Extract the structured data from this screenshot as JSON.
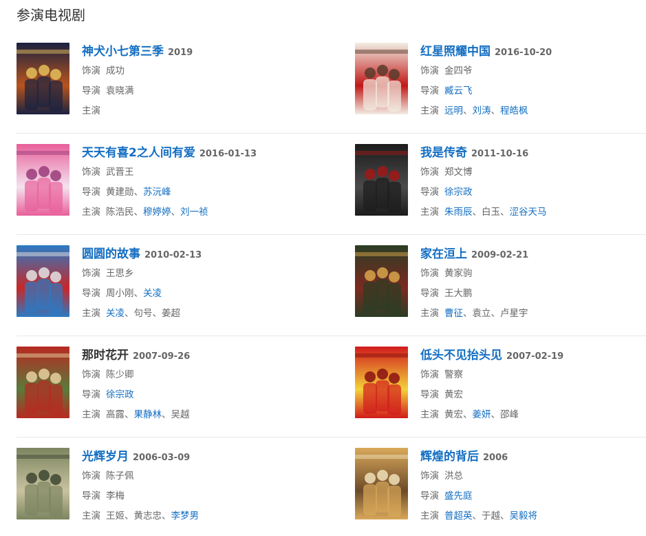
{
  "section_title": "参演电视剧",
  "labels": {
    "role": "饰演",
    "director": "导演",
    "cast": "主演"
  },
  "dramas": [
    {
      "title": "神犬小七第三季",
      "title_link": true,
      "year": "2019",
      "role": "成功",
      "directors": [
        {
          "name": "袁晓满",
          "link": false
        }
      ],
      "cast": [],
      "poster_colors": [
        "#1a2240",
        "#b8541e",
        "#e3c05b"
      ]
    },
    {
      "title": "红星照耀中国",
      "title_link": true,
      "year": "2016-10-20",
      "role": "金四爷",
      "directors": [
        {
          "name": "臧云飞",
          "link": true
        }
      ],
      "cast": [
        {
          "name": "远明",
          "link": true
        },
        {
          "name": "刘涛",
          "link": true
        },
        {
          "name": "程皓枫",
          "link": true
        }
      ],
      "poster_colors": [
        "#f2ede3",
        "#c01818",
        "#5a3b2c"
      ]
    },
    {
      "title": "天天有喜2之人间有爱",
      "title_link": true,
      "year": "2016-01-13",
      "role": "武晋王",
      "directors": [
        {
          "name": "黄建勋",
          "link": false
        },
        {
          "name": "苏沅峰",
          "link": true
        }
      ],
      "cast": [
        {
          "name": "陈浩民",
          "link": false
        },
        {
          "name": "穆婷婷",
          "link": true
        },
        {
          "name": "刘一祯",
          "link": true
        }
      ],
      "poster_colors": [
        "#e85f9a",
        "#f4e3ef",
        "#9a3b7a"
      ]
    },
    {
      "title": "我是传奇",
      "title_link": true,
      "year": "2011-10-16",
      "role": "郑文博",
      "directors": [
        {
          "name": "徐宗政",
          "link": true
        }
      ],
      "cast": [
        {
          "name": "朱雨辰",
          "link": true
        },
        {
          "name": "白玉",
          "link": false
        },
        {
          "name": "涩谷天马",
          "link": true
        }
      ],
      "poster_colors": [
        "#1c1c1c",
        "#4a4a4a",
        "#a01818"
      ]
    },
    {
      "title": "圆圆的故事",
      "title_link": true,
      "year": "2010-02-13",
      "role": "王思乡",
      "directors": [
        {
          "name": "周小刚",
          "link": false
        },
        {
          "name": "关凌",
          "link": true
        }
      ],
      "cast": [
        {
          "name": "关凌",
          "link": true
        },
        {
          "name": "句号",
          "link": false
        },
        {
          "name": "姜超",
          "link": false
        }
      ],
      "poster_colors": [
        "#2a7bc4",
        "#c82828",
        "#e3e3e3"
      ]
    },
    {
      "title": "家在洹上",
      "title_link": true,
      "year": "2009-02-21",
      "role": "黄家驹",
      "directors": [
        {
          "name": "王大鹏",
          "link": false
        }
      ],
      "cast": [
        {
          "name": "曹征",
          "link": true
        },
        {
          "name": "袁立",
          "link": false
        },
        {
          "name": "卢星宇",
          "link": false
        }
      ],
      "poster_colors": [
        "#2b3d24",
        "#7c2a20",
        "#d8a54a"
      ]
    },
    {
      "title": "那时花开",
      "title_link": false,
      "year": "2007-09-26",
      "role": "陈少卿",
      "directors": [
        {
          "name": "徐宗政",
          "link": true
        }
      ],
      "cast": [
        {
          "name": "高露",
          "link": false
        },
        {
          "name": "果静林",
          "link": true
        },
        {
          "name": "吴越",
          "link": false
        }
      ],
      "poster_colors": [
        "#b82a22",
        "#5a7a3a",
        "#e8d0a0"
      ]
    },
    {
      "title": "低头不见抬头见",
      "title_link": true,
      "year": "2007-02-19",
      "role": "警察",
      "directors": [
        {
          "name": "黄宏",
          "link": false
        }
      ],
      "cast": [
        {
          "name": "黄宏",
          "link": false
        },
        {
          "name": "姜妍",
          "link": true
        },
        {
          "name": "邵峰",
          "link": false
        }
      ],
      "poster_colors": [
        "#d11c1c",
        "#f3d23a",
        "#8a1010"
      ]
    },
    {
      "title": "光辉岁月",
      "title_link": true,
      "year": "2006-03-09",
      "role": "陈子佩",
      "directors": [
        {
          "name": "李梅",
          "link": false
        }
      ],
      "cast": [
        {
          "name": "王姬",
          "link": false
        },
        {
          "name": "黄志忠",
          "link": false
        },
        {
          "name": "李梦男",
          "link": true
        }
      ],
      "poster_colors": [
        "#7c8560",
        "#c9c2a0",
        "#3e4630"
      ]
    },
    {
      "title": "辉煌的背后",
      "title_link": true,
      "year": "2006",
      "role": "洪总",
      "directors": [
        {
          "name": "盛先庭",
          "link": true
        }
      ],
      "cast": [
        {
          "name": "普超英",
          "link": true
        },
        {
          "name": "于越",
          "link": false
        },
        {
          "name": "吴毅将",
          "link": true
        }
      ],
      "poster_colors": [
        "#d9a85a",
        "#6b4a2a",
        "#f0e0b8"
      ]
    }
  ]
}
